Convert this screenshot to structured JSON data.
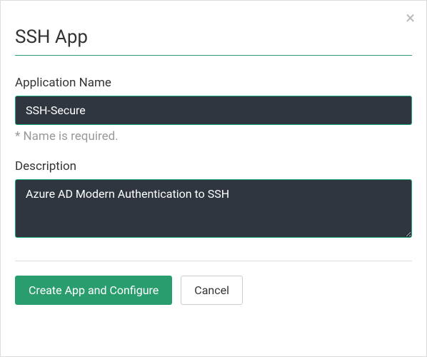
{
  "modal": {
    "title": "SSH App",
    "fields": {
      "appName": {
        "label": "Application Name",
        "value": "SSH-Secure",
        "hint": "* Name is required."
      },
      "description": {
        "label": "Description",
        "value": "Azure AD Modern Authentication to SSH"
      }
    },
    "buttons": {
      "primary": "Create App and Configure",
      "secondary": "Cancel"
    }
  }
}
